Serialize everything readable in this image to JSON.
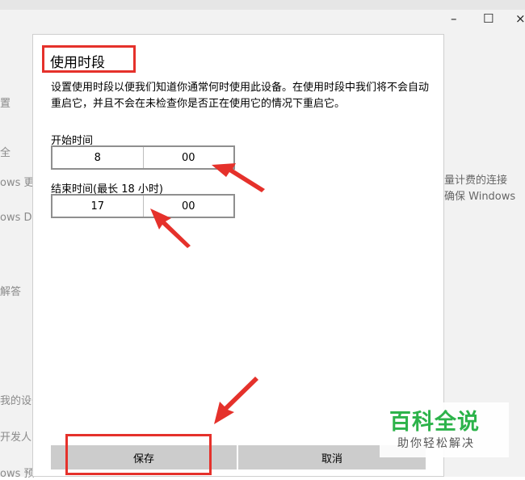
{
  "window": {
    "minimize_glyph": "–",
    "maximize_glyph": "☐",
    "close_glyph": "×"
  },
  "background_left": [
    "置",
    "全",
    "ows 更",
    "ows De",
    "解答",
    "我的设备",
    "开发人员",
    "ows 预"
  ],
  "background_right": [
    "量计费的连接",
    "确保 Windows"
  ],
  "dialog": {
    "title": "使用时段",
    "description": "设置使用时段以便我们知道你通常何时使用此设备。在使用时段中我们将不会自动重启它，并且不会在未检查你是否正在使用它的情况下重启它。",
    "start_label": "开始时间",
    "start_hour": "8",
    "start_minute": "00",
    "end_label": "结束时间(最长 18 小时)",
    "end_hour": "17",
    "end_minute": "00",
    "save_label": "保存",
    "cancel_label": "取消"
  },
  "watermark": {
    "main": "百科全说",
    "sub": "助你轻松解决"
  },
  "colors": {
    "highlight": "#e5312b",
    "watermark_green": "#2cb34a",
    "button_gray": "#cccccc"
  }
}
